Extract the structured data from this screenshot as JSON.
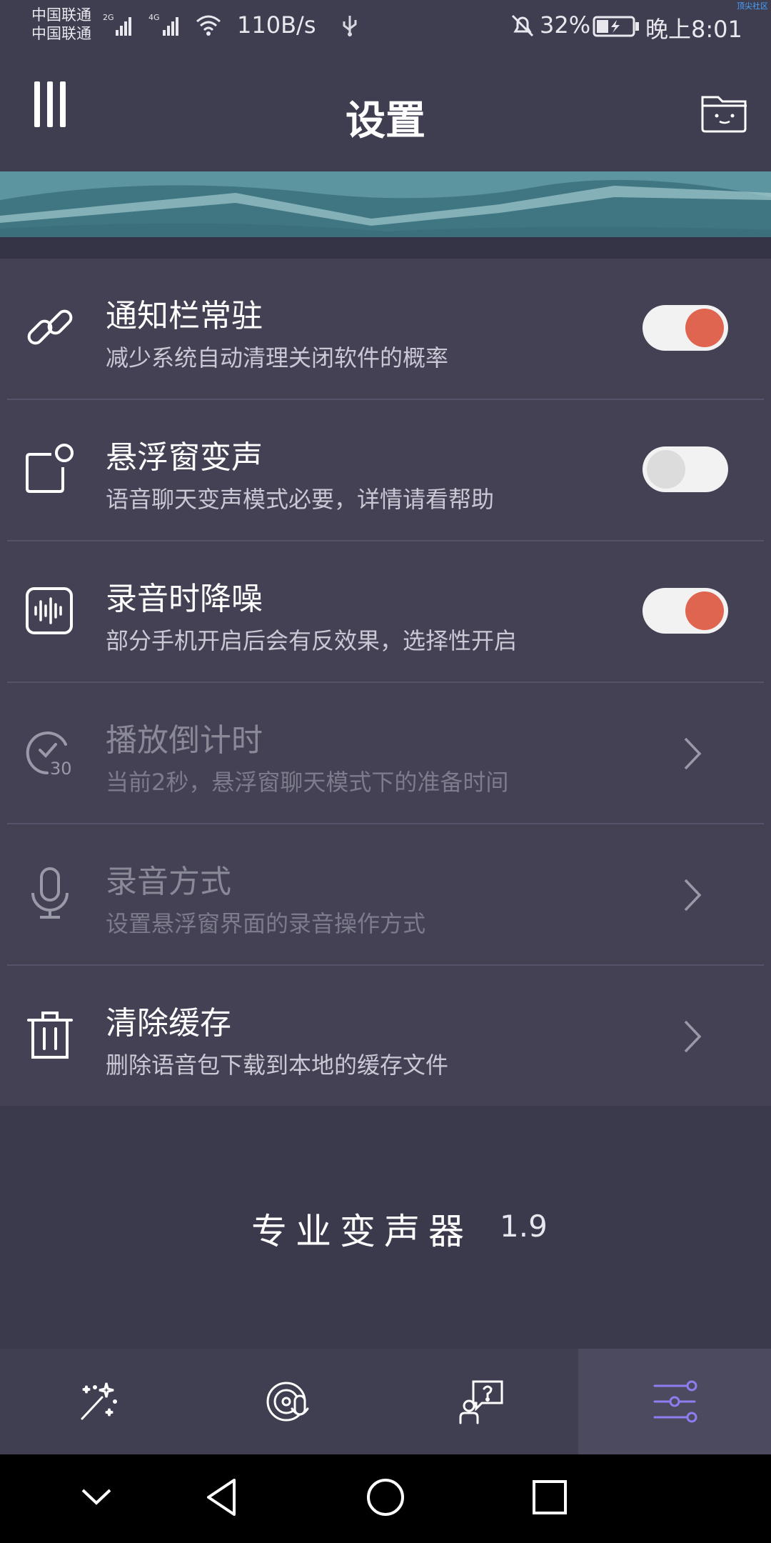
{
  "status_bar": {
    "carrier_1": "中国联通",
    "carrier_2": "中国联通",
    "net_speed": "110B/s",
    "battery_pct": "32%",
    "clock": "晚上8:01",
    "corner_note": "顶尖社区"
  },
  "header": {
    "title": "设置"
  },
  "settings": [
    {
      "title": "通知栏常驻",
      "subtitle": "减少系统自动清理关闭软件的概率",
      "icon": "link-icon",
      "control": "toggle",
      "on": true
    },
    {
      "title": "悬浮窗变声",
      "subtitle": "语音聊天变声模式必要，详情请看帮助",
      "icon": "floating-window-icon",
      "control": "toggle",
      "on": false
    },
    {
      "title": "录音时降噪",
      "subtitle": "部分手机开启后会有反效果，选择性开启",
      "icon": "noise-reduction-icon",
      "control": "toggle",
      "on": true
    },
    {
      "title": "播放倒计时",
      "subtitle": "当前2秒，悬浮窗聊天模式下的准备时间",
      "icon": "timer-icon",
      "control": "chevron"
    },
    {
      "title": "录音方式",
      "subtitle": "设置悬浮窗界面的录音操作方式",
      "icon": "microphone-icon",
      "control": "chevron"
    },
    {
      "title": "清除缓存",
      "subtitle": "删除语音包下载到本地的缓存文件",
      "icon": "trash-icon",
      "control": "chevron"
    }
  ],
  "footer": {
    "brand_name": "专业变声器",
    "version": "1.9"
  },
  "tabs": [
    {
      "icon": "magic-wand-icon",
      "active": false
    },
    {
      "icon": "voice-record-icon",
      "active": false
    },
    {
      "icon": "help-chat-icon",
      "active": false
    },
    {
      "icon": "settings-sliders-icon",
      "active": true
    }
  ],
  "colors": {
    "toggle_on": "#e06550",
    "toggle_off": "#dcdcdc",
    "active_tab_icon": "#8f7cf0",
    "background": "#3b3a4c"
  }
}
